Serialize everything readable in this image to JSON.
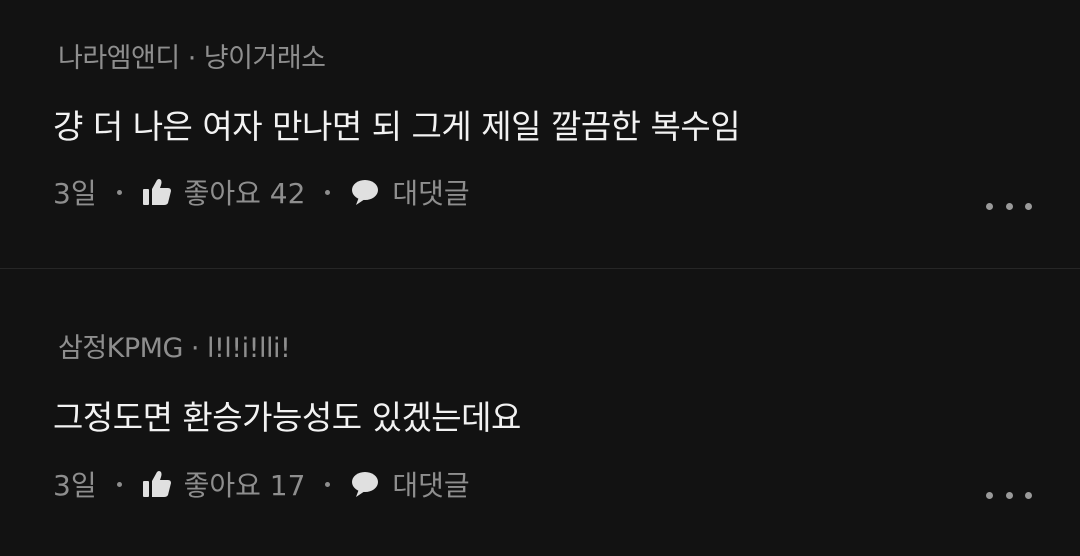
{
  "comments": [
    {
      "author": "나라엠앤디",
      "separator": "·",
      "board": "냥이거래소",
      "text": "걍 더 나은 여자 만나면 되 그게 제일 깔끔한 복수임",
      "time": "3일",
      "like_label": "좋아요 42",
      "reply_label": "대댓글",
      "like_icon": "thumbs-up-icon",
      "reply_icon": "speech-bubble-icon",
      "more_icon": "more-options-icon"
    },
    {
      "author": "삼정KPMG",
      "separator": "·",
      "board": "l!l!i!lli!",
      "text": "그정도면 환승가능성도 있겠는데요",
      "time": "3일",
      "like_label": "좋아요 17",
      "reply_label": "대댓글",
      "like_icon": "thumbs-up-icon",
      "reply_icon": "speech-bubble-icon",
      "more_icon": "more-options-icon"
    }
  ],
  "colors": {
    "background": "#121212",
    "primary_text": "#f2f2f2",
    "secondary_text": "#8e8e8e",
    "divider": "#262626"
  }
}
